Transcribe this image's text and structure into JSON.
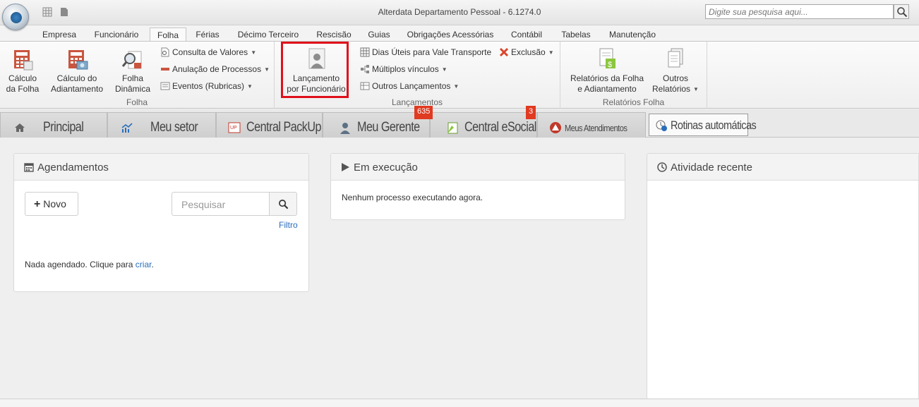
{
  "window": {
    "title": "Alterdata Departamento Pessoal - 6.1274.0"
  },
  "search": {
    "placeholder": "Digite sua pesquisa aqui..."
  },
  "ribbon_tabs": [
    "Empresa",
    "Funcionário",
    "Folha",
    "Férias",
    "Décimo Terceiro",
    "Rescisão",
    "Guias",
    "Obrigações Acessórias",
    "Contábil",
    "Tabelas",
    "Manutenção"
  ],
  "active_ribbon_tab": "Folha",
  "ribbon": {
    "folha": {
      "label": "Folha",
      "calculo_folha": [
        "Cálculo",
        "da Folha"
      ],
      "calculo_adiantamento": [
        "Cálculo do",
        "Adiantamento"
      ],
      "folha_dinamica": [
        "Folha",
        "Dinâmica"
      ],
      "consulta_valores": "Consulta de Valores",
      "anulacao_processos": "Anulação de Processos",
      "eventos_rubricas": "Eventos (Rubricas)"
    },
    "lancamentos": {
      "label": "Lançamentos",
      "lancamento_funcionario": [
        "Lançamento",
        "por Funcionário"
      ],
      "dias_uteis": "Dias Úteis para Vale Transporte",
      "multiplos_vinculos": "Múltiplos vínculos",
      "outros_lancamentos": "Outros Lançamentos",
      "exclusao": "Exclusão"
    },
    "relatorios": {
      "label": "Relatórios Folha",
      "relatorios_folha": [
        "Relatórios da Folha",
        "e Adiantamento"
      ],
      "outros_relatorios": [
        "Outros",
        "Relatórios"
      ]
    }
  },
  "module_tabs": {
    "principal": "Principal",
    "meu_setor": "Meu setor",
    "central_packup": "Central PackUp",
    "meu_gerente": "Meu Gerente",
    "meu_gerente_badge": "635",
    "central_esocial": "Central eSocial",
    "central_esocial_badge": "3",
    "meus_atendimentos": "Meus Atendimentos",
    "rotinas_automaticas": "Rotinas automáticas"
  },
  "panels": {
    "agendamentos": {
      "title": "Agendamentos",
      "novo_label": "Novo",
      "search_placeholder": "Pesquisar",
      "filtro_label": "Filtro",
      "empty_text": "Nada agendado. Clique para",
      "empty_link": "criar"
    },
    "em_execucao": {
      "title": "Em execução",
      "empty_text": "Nenhum processo executando agora."
    },
    "atividade_recente": {
      "title": "Atividade recente"
    }
  },
  "colors": {
    "highlight": "#e0101a",
    "badge": "#e03a21",
    "link": "#2a6ebb"
  }
}
